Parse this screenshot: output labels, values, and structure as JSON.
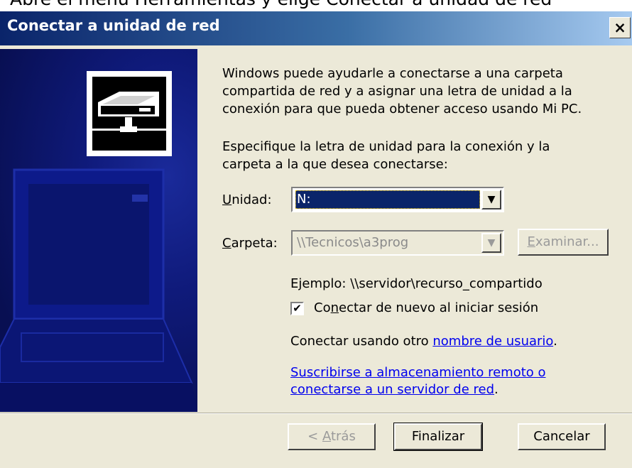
{
  "background_text": "Abre el menú Herramientas y elige Conectar a unidad de red",
  "dialog": {
    "title": "Conectar a unidad de red",
    "close_glyph": "×",
    "intro": "Windows puede ayudarle a conectarse a una carpeta compartida de red y a asignar una letra de unidad a la conexión para que pueda obtener acceso usando Mi PC.",
    "instructions": "Especifique la letra de unidad para la conexión y la carpeta a la que desea conectarse:",
    "drive": {
      "label_first": "U",
      "label_rest": "nidad:",
      "value": "N:"
    },
    "folder": {
      "label_first": "C",
      "label_rest": "arpeta:",
      "value": "\\\\Tecnicos\\a3prog",
      "browse_first": "E",
      "browse_rest": "xaminar..."
    },
    "example": "Ejemplo: \\\\servidor\\recurso_compartido",
    "reconnect": {
      "checked": true,
      "check_glyph": "✔",
      "label_before": "Co",
      "label_accel": "n",
      "label_after": "ectar de nuevo al iniciar sesión"
    },
    "other_user_text": "Conectar usando otro ",
    "other_user_link": "nombre de usuario",
    "other_user_suffix": ".",
    "subscribe_link_line1": "Suscribirse a almacenamiento remoto o",
    "subscribe_link_line2": "conectarse a un servidor de red",
    "subscribe_suffix": ".",
    "dropdown_arrow": "▼"
  },
  "buttons": {
    "back_prefix": "< ",
    "back_accel": "A",
    "back_rest": "trás",
    "finish": "Finalizar",
    "cancel": "Cancelar"
  },
  "colors": {
    "title_bar": "#0a246a",
    "selection": "#0a246a",
    "link": "#0000ee",
    "dialog_bg": "#ece9d8",
    "side_panel": "#0f1a7a"
  }
}
